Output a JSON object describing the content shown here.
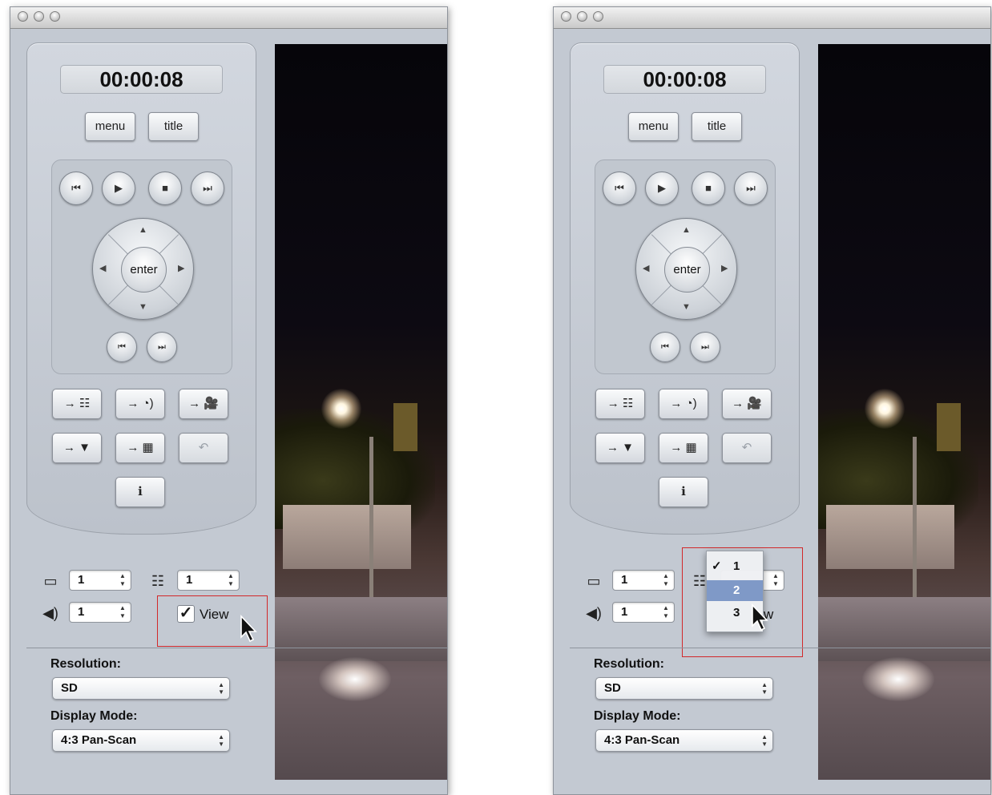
{
  "panels": [
    {
      "timecode": "00:00:08",
      "buttons": {
        "menu": "menu",
        "title": "title",
        "enter": "enter"
      },
      "transport": {
        "prev": "⏮",
        "play": "▶",
        "stop": "■",
        "next": "⏭",
        "chapter_prev": "⏮",
        "chapter_next": "⏭"
      },
      "function_buttons": [
        "→ ☷",
        "→ ◔)",
        "→ 🎥",
        "→ ▼",
        "→ ▦",
        "↶",
        "ℹ"
      ],
      "status": {
        "video_stream": "1",
        "subtitle_stream": "1",
        "audio_stream": "1",
        "view_checked": true,
        "view_label": "View"
      },
      "resolution": {
        "label": "Resolution:",
        "value": "SD"
      },
      "display_mode": {
        "label": "Display Mode:",
        "value": "4:3 Pan-Scan"
      }
    },
    {
      "timecode": "00:00:08",
      "buttons": {
        "menu": "menu",
        "title": "title",
        "enter": "enter"
      },
      "transport": {
        "prev": "⏮",
        "play": "▶",
        "stop": "■",
        "next": "⏭",
        "chapter_prev": "⏮",
        "chapter_next": "⏭"
      },
      "function_buttons": [
        "→ ☷",
        "→ ◔)",
        "→ 🎥",
        "→ ▼",
        "→ ▦",
        "↶",
        "ℹ"
      ],
      "status": {
        "video_stream": "1",
        "audio_stream": "1",
        "view_partial": "w",
        "subtitle_menu": {
          "options": [
            "1",
            "2",
            "3"
          ],
          "checked": "1",
          "highlighted": "2",
          "checkmark": "✓"
        }
      },
      "resolution": {
        "label": "Resolution:",
        "value": "SD"
      },
      "display_mode": {
        "label": "Display Mode:",
        "value": "4:3 Pan-Scan"
      }
    }
  ]
}
